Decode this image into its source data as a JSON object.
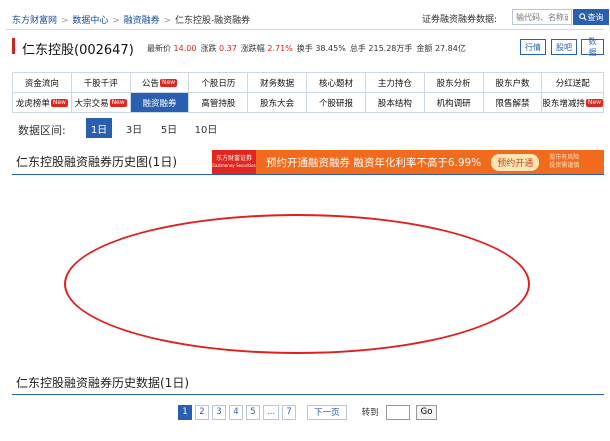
{
  "breadcrumb": [
    "东方财富网",
    "数据中心",
    "融资融券",
    "仁东控股-融资融券"
  ],
  "breadcrumb_sep": ">",
  "search": {
    "label": "证券融资融券数据:",
    "placeholder": "输代码、名称或简拼",
    "button": "查询"
  },
  "stock": {
    "title": "仁东控股(002647)",
    "quote": [
      {
        "label": "最新价",
        "value": "14.00",
        "red": true
      },
      {
        "label": "涨跌",
        "value": "0.37",
        "red": true
      },
      {
        "label": "涨跌幅",
        "value": "2.71%",
        "red": true
      },
      {
        "label": "换手",
        "value": "38.45%",
        "red": false
      },
      {
        "label": "总手",
        "value": "215.28万手",
        "red": false
      },
      {
        "label": "金额",
        "value": "27.84亿",
        "red": false
      }
    ],
    "buttons": [
      "行情",
      "股吧",
      "数据"
    ]
  },
  "nav": [
    {
      "label": "资金流向",
      "new": false,
      "active": false
    },
    {
      "label": "千股千评",
      "new": false,
      "active": false
    },
    {
      "label": "公告",
      "new": true,
      "active": false
    },
    {
      "label": "个股日历",
      "new": false,
      "active": false
    },
    {
      "label": "财务数据",
      "new": false,
      "active": false
    },
    {
      "label": "核心题材",
      "new": false,
      "active": false
    },
    {
      "label": "主力持仓",
      "new": false,
      "active": false
    },
    {
      "label": "股东分析",
      "new": false,
      "active": false
    },
    {
      "label": "股东户数",
      "new": false,
      "active": false
    },
    {
      "label": "分红送配",
      "new": false,
      "active": false
    },
    {
      "label": "龙虎榜单",
      "new": true,
      "active": false
    },
    {
      "label": "大宗交易",
      "new": true,
      "active": false
    },
    {
      "label": "融资融券",
      "new": false,
      "active": true
    },
    {
      "label": "高管持股",
      "new": false,
      "active": false
    },
    {
      "label": "股东大会",
      "new": false,
      "active": false
    },
    {
      "label": "个股研报",
      "new": false,
      "active": false
    },
    {
      "label": "股本结构",
      "new": false,
      "active": false
    },
    {
      "label": "机构调研",
      "new": false,
      "active": false
    },
    {
      "label": "限售解禁",
      "new": false,
      "active": false
    },
    {
      "label": "股东增减持",
      "new": true,
      "active": false
    }
  ],
  "new_badge": "New",
  "range": {
    "label": "数据区间:",
    "options": [
      "1日",
      "3日",
      "5日",
      "10日"
    ],
    "selected": "1日"
  },
  "chart_section": {
    "title": "仁东控股融资融券历史图(1日)"
  },
  "ad": {
    "logo_line1": "东方财富证券",
    "logo_line2": "Eastmoney Securities",
    "text": "预约开通融资融券  融资年化利率不高于6.99%",
    "button": "预约开通",
    "risk_line1": "股市有风险",
    "risk_line2": "投资需谨慎"
  },
  "data_section": {
    "title": "仁东控股融资融券历史数据(1日)"
  },
  "pager": {
    "pages": [
      "1",
      "2",
      "3",
      "4",
      "5",
      "...",
      "7"
    ],
    "current": "1",
    "next": "下一页",
    "goto_label": "转到",
    "goto_button": "Go"
  },
  "colors": {
    "accent": "#2a5fb0",
    "red": "#e0221d",
    "ad": "#f26b1d",
    "annotation": "#e02020"
  }
}
